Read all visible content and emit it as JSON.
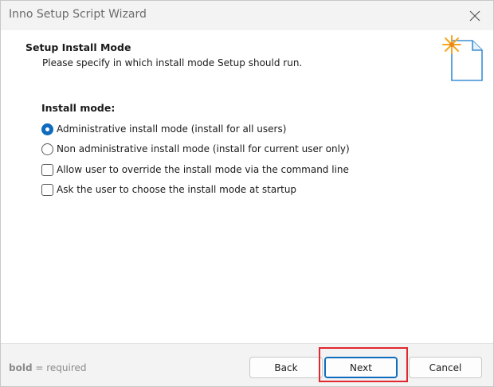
{
  "window": {
    "title": "Inno Setup Script Wizard"
  },
  "header": {
    "title": "Setup Install Mode",
    "subtitle": "Please specify in which install mode Setup should run."
  },
  "install_mode": {
    "group_label": "Install mode:",
    "options": [
      {
        "label": "Administrative install mode (install for all users)",
        "type": "radio",
        "checked": true
      },
      {
        "label": "Non administrative install mode (install for current user only)",
        "type": "radio",
        "checked": false
      },
      {
        "label": "Allow user to override the install mode via the command line",
        "type": "checkbox",
        "checked": false
      },
      {
        "label": "Ask the user to choose the install mode at startup",
        "type": "checkbox",
        "checked": false
      }
    ]
  },
  "footer": {
    "legend_bold": "bold",
    "legend_rest": "= required",
    "back_label": "Back",
    "next_label": "Next",
    "cancel_label": "Cancel"
  },
  "colors": {
    "accent": "#0f6cbd",
    "highlight": "#e0282e",
    "icon_star": "#f5a623"
  },
  "icons": {
    "close": "close-icon",
    "wizard": "new-document-star-icon"
  }
}
